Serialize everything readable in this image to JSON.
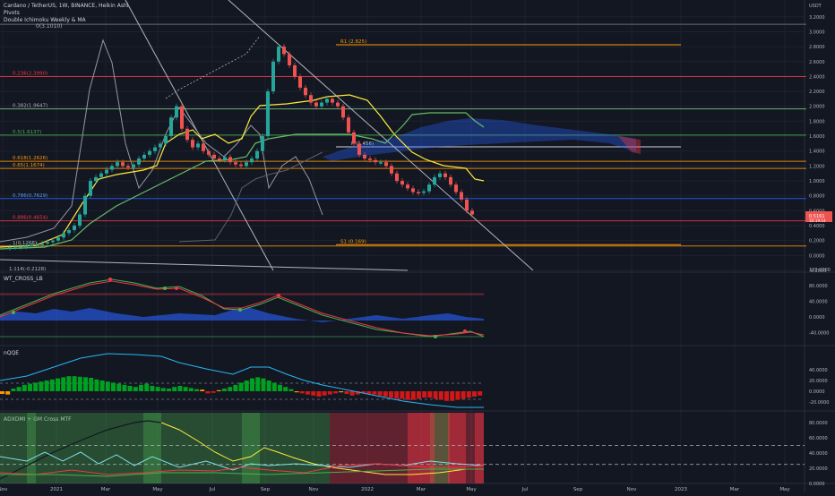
{
  "header": {
    "symbol_line": "Cardano / TetherUS, 1W, BINANCE, Heikin Ashi",
    "indicators": [
      "Pivots",
      "Double Ichimoku Weekly & MA"
    ],
    "extra": "0(3.1010)"
  },
  "price_axis": {
    "currency": "USDT",
    "ticks": [
      "3.2000",
      "3.0000",
      "2.8000",
      "2.6000",
      "2.4000",
      "2.2000",
      "2.0000",
      "1.8000",
      "1.6000",
      "1.4000",
      "1.2000",
      "1.0000",
      "0.8000",
      "0.6000",
      "0.4000",
      "0.2000",
      "0.0000",
      "-0.2000"
    ],
    "last_price": "0.5161",
    "last_sub": "1D 19:14"
  },
  "time_axis": [
    "Nov",
    "2021",
    "Mar",
    "May",
    "Jul",
    "Sep",
    "Nov",
    "2022",
    "Mar",
    "May",
    "Jul",
    "Sep",
    "Nov",
    "2023",
    "Mar",
    "May"
  ],
  "fib_labels": {
    "r236": "0.236(2.3990)",
    "r382": "0.382(1.9647)",
    "r5": "0.5(1.6137)",
    "r618": "0.618(1.2626)",
    "r65": "0.65(1.1674)",
    "r786": "0.786(0.7629)",
    "r886": "0.886(0.4654)",
    "r1": "1(0.1268)",
    "r1114": "1.114(-0.2128)"
  },
  "pivot_labels": {
    "r1": "R1 (2.825)",
    "s1": "S1 (0.169)",
    "p": "P (1.456)"
  },
  "colors": {
    "up": "#26a69a",
    "down": "#ef5350",
    "fib_red": "#f23645",
    "fib_orange": "#ff9800",
    "fib_green": "#4caf50",
    "fib_blue": "#2962ff",
    "tenkan": "#ffeb3b"
  },
  "panels": {
    "wt": {
      "title": "WT_CROSS_LB",
      "ticks": [
        "120.0000",
        "80.0000",
        "40.0000",
        "0.0000",
        "-40.0000"
      ]
    },
    "nqqe": {
      "title": "nQQE",
      "ticks": [
        "40.0000",
        "20.0000",
        "0.0000",
        "-20.0000"
      ]
    },
    "adx": {
      "title": "ADXDMI + GM Cross MTF",
      "ticks": [
        "80.0000",
        "60.0000",
        "40.0000",
        "20.0000",
        "0.0000"
      ]
    }
  },
  "chart_data": {
    "type": "candlestick",
    "ohlc_heikin_ashi_approx": [
      0.1,
      0.11,
      0.11,
      0.12,
      0.13,
      0.14,
      0.15,
      0.16,
      0.18,
      0.2,
      0.24,
      0.3,
      0.34,
      0.4,
      0.55,
      0.8,
      1.0,
      1.05,
      1.1,
      1.15,
      1.2,
      1.25,
      1.2,
      1.18,
      1.22,
      1.3,
      1.35,
      1.4,
      1.45,
      1.5,
      1.6,
      1.85,
      2.0,
      1.7,
      1.55,
      1.45,
      1.5,
      1.4,
      1.35,
      1.3,
      1.28,
      1.32,
      1.25,
      1.22,
      1.2,
      1.25,
      1.3,
      1.4,
      1.6,
      2.2,
      2.6,
      2.8,
      2.7,
      2.55,
      2.4,
      2.25,
      2.15,
      2.05,
      2.0,
      2.05,
      2.1,
      2.05,
      2.0,
      1.85,
      1.65,
      1.5,
      1.35,
      1.3,
      1.28,
      1.25,
      1.25,
      1.2,
      1.1,
      1.0,
      0.95,
      0.9,
      0.85,
      0.84,
      0.86,
      0.95,
      1.05,
      1.1,
      1.05,
      0.95,
      0.85,
      0.75,
      0.6,
      0.55
    ],
    "yrange": [
      -0.2,
      3.25
    ]
  }
}
